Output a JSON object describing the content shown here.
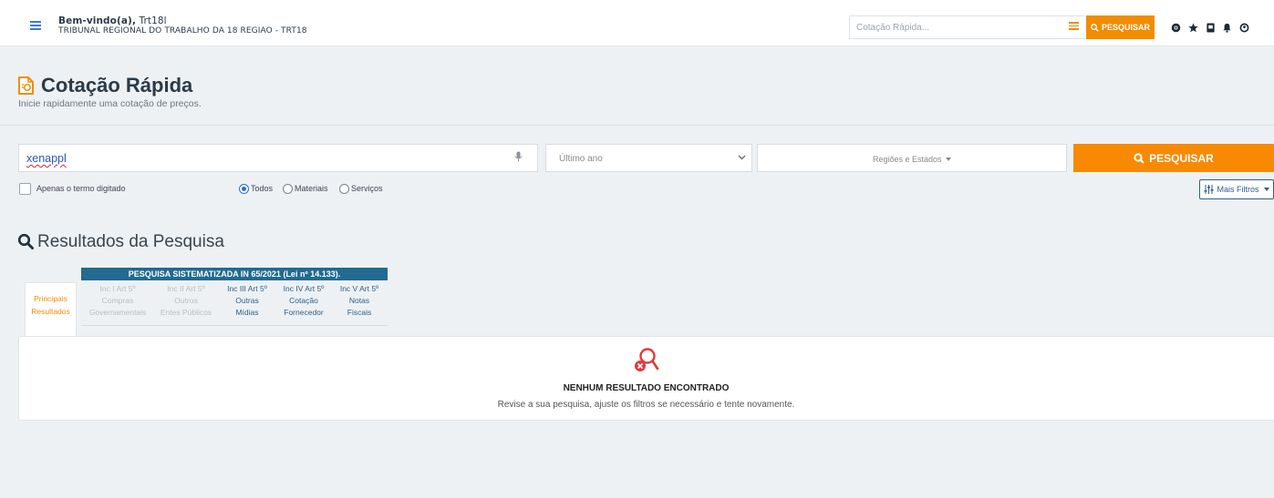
{
  "header": {
    "welcome_prefix": "Bem-vindo(a),",
    "user_name": "Trt18l",
    "organization": "TRIBUNAL REGIONAL DO TRABALHO DA 18 REGIAO - TRT18",
    "quick_search_placeholder": "Cotação Rápida...",
    "quick_search_button": "PESQUISAR",
    "icons": [
      "menu-icon",
      "list-icon",
      "support-icon",
      "star-icon",
      "bookmark-icon",
      "bell-icon",
      "user-icon"
    ]
  },
  "page": {
    "title": "Cotação Rápida",
    "subtitle": "Inicie rapidamente uma cotação de preços."
  },
  "search": {
    "value": "xenappl",
    "period": "Último ano",
    "regions": "Regiões e Estados",
    "button": "PESQUISAR",
    "exact_term_label": "Apenas o termo digitado",
    "exact_term_checked": false,
    "types": [
      {
        "label": "Todos",
        "selected": true
      },
      {
        "label": "Materiais",
        "selected": false
      },
      {
        "label": "Serviços",
        "selected": false
      }
    ],
    "more_filters": "Mais Filtros"
  },
  "results": {
    "title": "Resultados da Pesquisa",
    "table_heading": "PESQUISA SISTEMATIZADA IN 65/2021 (Lei nº 14.133).",
    "main_tab": [
      "Principais",
      "Resultados"
    ],
    "tabs": [
      {
        "lines": [
          "Inc I Art 5º",
          "Compras",
          "Governamentais"
        ],
        "enabled": false
      },
      {
        "lines": [
          "Inc II Art 5º",
          "Outros",
          "Entes Públicos"
        ],
        "enabled": false
      },
      {
        "lines": [
          "Inc III Art 5º",
          "Outras",
          "Mídias"
        ],
        "enabled": true
      },
      {
        "lines": [
          "Inc IV Art 5º",
          "Cotação",
          "Fornecedor"
        ],
        "enabled": true
      },
      {
        "lines": [
          "Inc V Art 5º",
          "Notas",
          "Fiscais"
        ],
        "enabled": true
      }
    ],
    "empty_title": "NENHUM RESULTADO ENCONTRADO",
    "empty_message": "Revise a sua pesquisa, ajuste os filtros se necessário e tente novamente."
  },
  "colors": {
    "accent": "#f88a03",
    "brand_blue": "#226a8f",
    "error": "#e0393e"
  }
}
